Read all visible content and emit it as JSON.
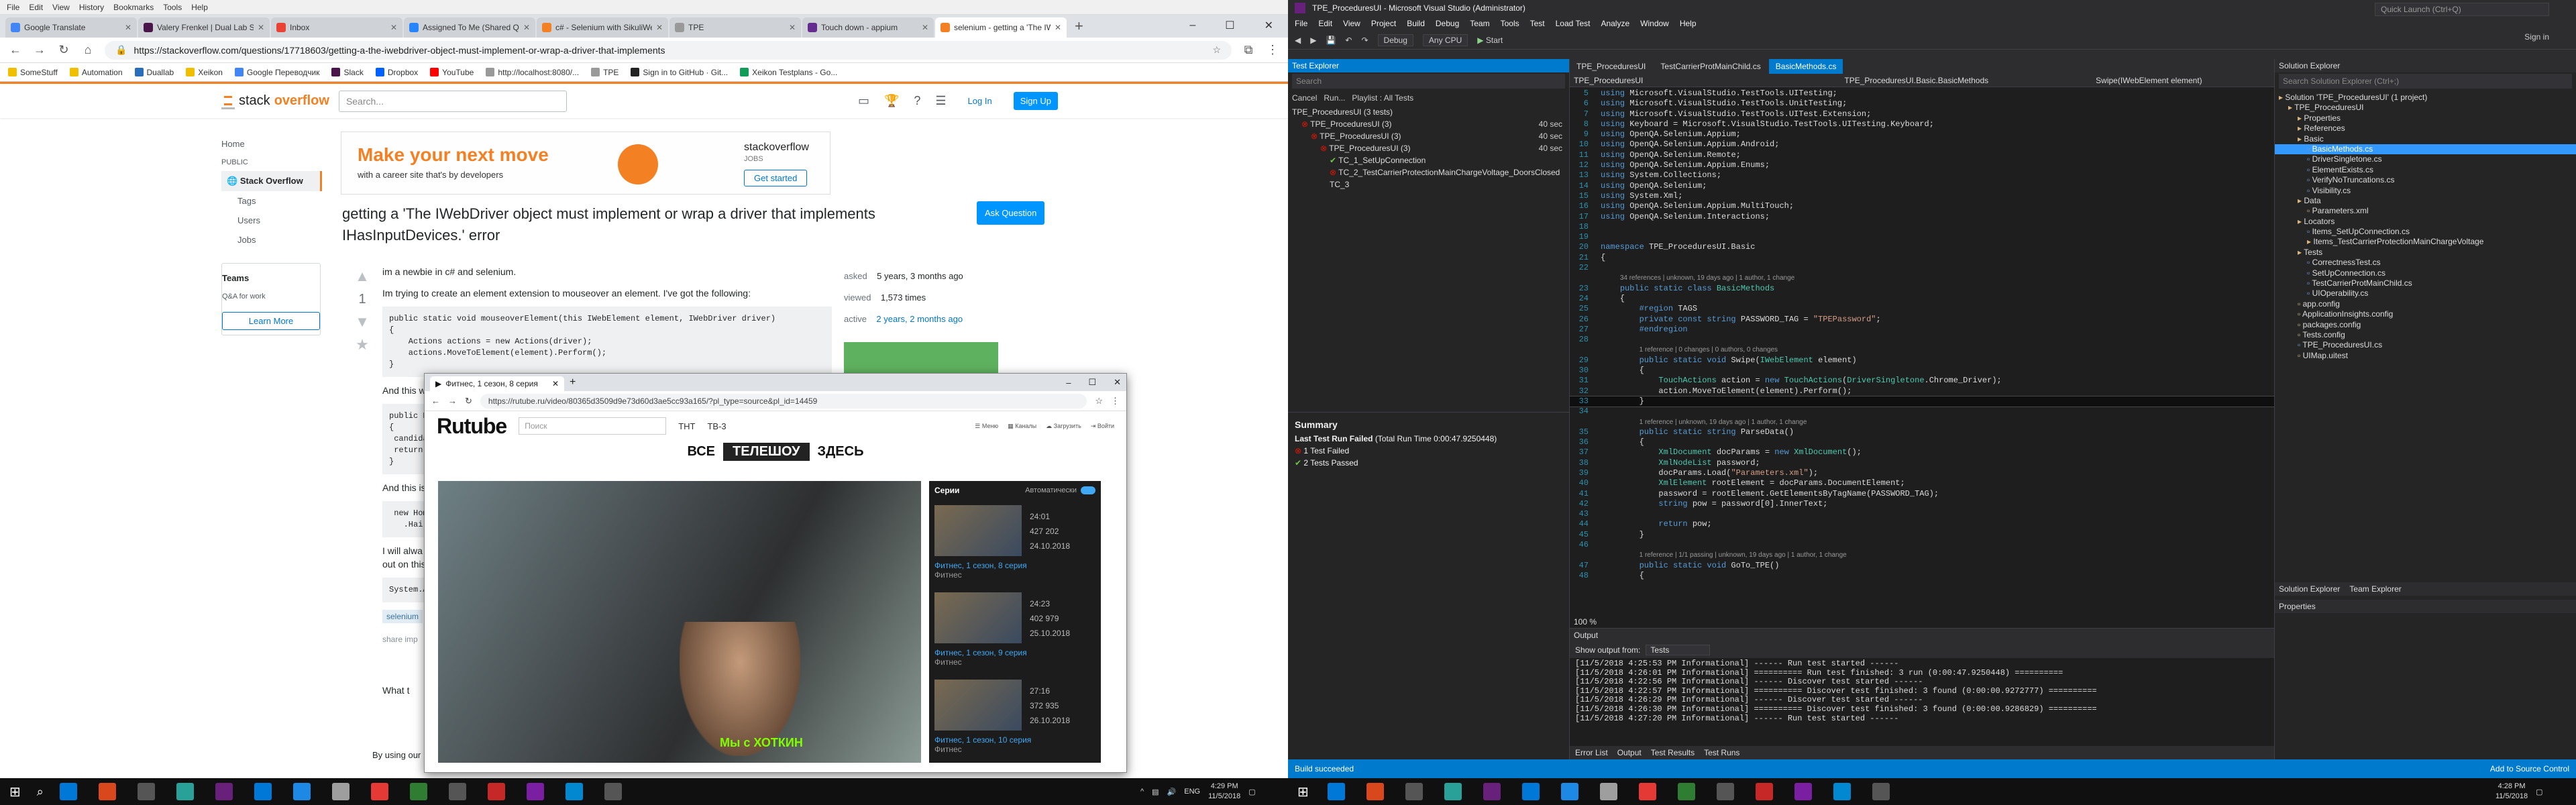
{
  "chrome": {
    "menu": [
      "File",
      "Edit",
      "View",
      "History",
      "Bookmarks",
      "Tools",
      "Help"
    ],
    "tabs": [
      {
        "label": "Google Translate",
        "color": "#4285f4",
        "active": false
      },
      {
        "label": "Valery Frenkel | Dual Lab Slack",
        "color": "#4a154b",
        "active": false
      },
      {
        "label": "Inbox",
        "color": "#ea4335",
        "active": false
      },
      {
        "label": "Assigned To Me (Shared Queue)",
        "color": "#2684ff",
        "active": false
      },
      {
        "label": "c# - Selenium with SikuliWebDriver",
        "color": "#f48024",
        "active": false
      },
      {
        "label": "TPE",
        "color": "#999999",
        "active": false
      },
      {
        "label": "Touch down - appium",
        "color": "#662d91",
        "active": false
      },
      {
        "label": "selenium - getting a 'The IWebDriver",
        "color": "#f48024",
        "active": true
      }
    ],
    "url": "https://stackoverflow.com/questions/17718603/getting-a-the-iwebdriver-object-must-implement-or-wrap-a-driver-that-implements",
    "bookmarks": [
      {
        "label": "SomeStuff",
        "color": "#f0c000"
      },
      {
        "label": "Automation",
        "color": "#f0c000"
      },
      {
        "label": "Duallab",
        "color": "#2a6ebb"
      },
      {
        "label": "Xeikon",
        "color": "#f0c000"
      },
      {
        "label": "Google Переводчик",
        "color": "#4285f4"
      },
      {
        "label": "Slack",
        "color": "#4a154b"
      },
      {
        "label": "Dropbox",
        "color": "#0061ff"
      },
      {
        "label": "YouTube",
        "color": "#ff0000"
      },
      {
        "label": "http://localhost:8080/...",
        "color": "#999999"
      },
      {
        "label": "TPE",
        "color": "#999999"
      },
      {
        "label": "Sign in to GitHub · Git...",
        "color": "#222222"
      },
      {
        "label": "Xeikon Testplans - Go...",
        "color": "#0f9d58"
      }
    ]
  },
  "so": {
    "logo_a": "stack",
    "logo_b": "overflow",
    "search_placeholder": "Search...",
    "login": "Log In",
    "signup": "Sign Up",
    "nav": {
      "home": "Home",
      "public": "PUBLIC",
      "stack": "Stack Overflow",
      "tags": "Tags",
      "users": "Users",
      "jobs": "Jobs"
    },
    "teams": {
      "title": "Teams",
      "subtitle": "Q&A for work",
      "button": "Learn More"
    },
    "ad": {
      "headline": "Make your next move",
      "sub": "with a career site that's by developers",
      "logo": "stackoverflow",
      "jobs": "JOBS",
      "cta": "Get started"
    },
    "question_title": "getting a 'The IWebDriver object must implement or wrap a driver that implements IHasInputDevices.' error",
    "ask_button": "Ask Question",
    "vote_count": "1",
    "body_p1": "im a newbie in c# and selenium.",
    "body_p2": "Im trying to create an element extension to mouseover an element. I've got the following:",
    "code1": "public static void mouseoverElement(this IWebElement element, IWebDriver driver)\n{\n    Actions actions = new Actions(driver);\n    actions.MoveToElement(element).Perform();\n}",
    "body_p3": "And this w",
    "code2": "public Ho\n{\n candidat\n return t\n}",
    "body_p4": "And this is",
    "code3": " new Home\n   .Hai",
    "body_p5": "I will alwa\nout on this",
    "code4": "System.A",
    "tag": "selenium",
    "share": "share  imp",
    "answer_snip": "What t",
    "cookie_snip": "By using our",
    "meta": {
      "asked_label": "asked",
      "asked": "5 years, 3 months ago",
      "viewed_label": "viewed",
      "viewed": "1,573 times",
      "active_label": "active",
      "active": "2 years, 2 months ago"
    }
  },
  "rutube": {
    "tab_title": "Фитнес, 1 сезон, 8 серия",
    "url": "https://rutube.ru/video/80365d3509d9e73d60d3ae5cc93a165/?pl_type=source&pl_id=14459",
    "logo": "Rutube",
    "search_placeholder": "Поиск",
    "nav": [
      "ТНТ",
      "ТВ-3"
    ],
    "menu_labels": [
      "Меню",
      "Каналы",
      "Загрузить",
      "Войти"
    ],
    "banner": {
      "left": "ВСЕ",
      "mid": "ТЕЛЕШОУ",
      "right": "ЗДЕСЬ"
    },
    "list_title": "Серии",
    "autoplay": "Автоматически",
    "caption": "Мы с ХОТКИН",
    "episodes": [
      {
        "time": "24:01",
        "views": "427 202",
        "date": "24.10.2018",
        "title": "Фитнес, 1 сезон, 8 серия",
        "channel": "Фитнес"
      },
      {
        "time": "24:23",
        "views": "402 979",
        "date": "25.10.2018",
        "title": "Фитнес, 1 сезон, 9 серия",
        "channel": "Фитнес"
      },
      {
        "time": "27:16",
        "views": "372 935",
        "date": "26.10.2018",
        "title": "Фитнес, 1 сезон, 10 серия",
        "channel": "Фитнес"
      }
    ]
  },
  "vs": {
    "title": "TPE_ProceduresUI - Microsoft Visual Studio (Administrator)",
    "menu": [
      "File",
      "Edit",
      "View",
      "Project",
      "Build",
      "Debug",
      "Team",
      "Tools",
      "Test",
      "Load Test",
      "Analyze",
      "Window",
      "Help"
    ],
    "toolbar": {
      "config": "Debug",
      "platform": "Any CPU",
      "start": "Start"
    },
    "quick_launch": "Quick Launch (Ctrl+Q)",
    "signin": "Sign in",
    "test_explorer": {
      "title": "Test Explorer",
      "search": "Search",
      "cancel": "Cancel",
      "run": "Run...",
      "playlist": "Playlist : All Tests",
      "rows": [
        {
          "label": "TPE_ProceduresUI (3 tests)",
          "dur": "",
          "indent": 0,
          "status": ""
        },
        {
          "label": "TPE_ProceduresUI (3)",
          "dur": "40 sec",
          "indent": 1,
          "status": "fail"
        },
        {
          "label": "TPE_ProceduresUI (3)",
          "dur": "40 sec",
          "indent": 2,
          "status": "fail"
        },
        {
          "label": "TPE_ProceduresUI (3)",
          "dur": "40 sec",
          "indent": 3,
          "status": "fail"
        },
        {
          "label": "TC_1_SetUpConnection",
          "dur": "",
          "indent": 4,
          "status": "pass"
        },
        {
          "label": "TC_2_TestCarrierProtectionMainChargeVoltage_DoorsClosed",
          "dur": "",
          "indent": 4,
          "status": "fail"
        },
        {
          "label": "TC_3",
          "dur": "",
          "indent": 4,
          "status": ""
        }
      ],
      "summary_title": "Summary",
      "last_run": "Last Test Run Failed",
      "total": "(Total Run Time 0:00:47.9250448)",
      "failed": "1 Test Failed",
      "passed": "2 Tests Passed"
    },
    "editor": {
      "tabs": [
        "TPE_ProceduresUI",
        "TestCarrierProtMainChild.cs",
        "BasicMethods.cs"
      ],
      "nav": [
        "TPE_ProceduresUI",
        "TPE_ProceduresUI.Basic.BasicMethods",
        "Swipe(IWebElement element)"
      ],
      "zoom": "100 %"
    },
    "output": {
      "title": "Output",
      "show_from_label": "Show output from:",
      "show_from": "Tests",
      "lines": [
        "[11/5/2018 4:25:53 PM Informational] ------ Run test started ------",
        "[11/5/2018 4:26:01 PM Informational] ========== Run test finished: 3 run (0:00:47.9250448) ==========",
        "[11/5/2018 4:22:56 PM Informational] ------ Discover test started ------",
        "[11/5/2018 4:22:57 PM Informational] ========== Discover test finished: 3 found (0:00:00.9272777) ==========",
        "[11/5/2018 4:26:29 PM Informational] ------ Discover test started ------",
        "[11/5/2018 4:26:30 PM Informational] ========== Discover test finished: 3 found (0:00:00.9286829) ==========",
        "[11/5/2018 4:27:20 PM Informational] ------ Run test started ------"
      ],
      "tabs": [
        "Error List",
        "Output",
        "Test Results",
        "Test Runs"
      ]
    },
    "solution": {
      "title": "Solution Explorer",
      "search": "Search Solution Explorer (Ctrl+;)",
      "rows": [
        {
          "label": "Solution 'TPE_ProceduresUI' (1 project)",
          "indent": 0,
          "sel": false
        },
        {
          "label": "TPE_ProceduresUI",
          "indent": 1,
          "sel": false
        },
        {
          "label": "Properties",
          "indent": 2,
          "sel": false
        },
        {
          "label": "References",
          "indent": 2,
          "sel": false
        },
        {
          "label": "Basic",
          "indent": 2,
          "sel": false
        },
        {
          "label": "BasicMethods.cs",
          "indent": 3,
          "sel": true
        },
        {
          "label": "DriverSingletone.cs",
          "indent": 3,
          "sel": false
        },
        {
          "label": "ElementExists.cs",
          "indent": 3,
          "sel": false
        },
        {
          "label": "VerifyNoTruncations.cs",
          "indent": 3,
          "sel": false
        },
        {
          "label": "Visibility.cs",
          "indent": 3,
          "sel": false
        },
        {
          "label": "Data",
          "indent": 2,
          "sel": false
        },
        {
          "label": "Parameters.xml",
          "indent": 3,
          "sel": false
        },
        {
          "label": "Locators",
          "indent": 2,
          "sel": false
        },
        {
          "label": "Items_SetUpConnection.cs",
          "indent": 3,
          "sel": false
        },
        {
          "label": "Items_TestCarrierProtectionMainChargeVoltage",
          "indent": 3,
          "sel": false
        },
        {
          "label": "Tests",
          "indent": 2,
          "sel": false
        },
        {
          "label": "CorrectnessTest.cs",
          "indent": 3,
          "sel": false
        },
        {
          "label": "SetUpConnection.cs",
          "indent": 3,
          "sel": false
        },
        {
          "label": "TestCarrierProtMainChild.cs",
          "indent": 3,
          "sel": false
        },
        {
          "label": "UIOperability.cs",
          "indent": 3,
          "sel": false
        },
        {
          "label": "app.config",
          "indent": 2,
          "sel": false
        },
        {
          "label": "ApplicationInsights.config",
          "indent": 2,
          "sel": false
        },
        {
          "label": "packages.config",
          "indent": 2,
          "sel": false
        },
        {
          "label": "Tests.config",
          "indent": 2,
          "sel": false
        },
        {
          "label": "TPE_ProceduresUI.cs",
          "indent": 2,
          "sel": false
        },
        {
          "label": "UIMap.uitest",
          "indent": 2,
          "sel": false
        }
      ],
      "bottom_tabs": [
        "Solution Explorer",
        "Team Explorer"
      ],
      "properties": "Properties"
    },
    "status": {
      "left": "Build succeeded",
      "right": "Add to Source Control"
    }
  },
  "taskbar": {
    "lang": "ENG",
    "time": "4:29 PM",
    "date": "11/5/2018",
    "time2": "4:28 PM",
    "date2": "11/5/2018",
    "app_colors": [
      "#0078d7",
      "#d9481c",
      "#555555",
      "#2aa198",
      "#68217a",
      "#0078d7",
      "#1e88e5",
      "#9e9e9e",
      "#e53935",
      "#2f7d32",
      "#555555",
      "#c62828",
      "#7b1fa2",
      "#0288d1",
      "#555555"
    ]
  }
}
